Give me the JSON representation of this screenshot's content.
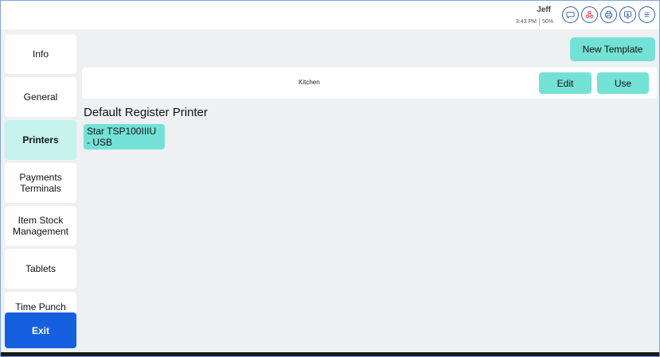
{
  "header": {
    "user_name": "Jeff",
    "time": "3:43 PM",
    "battery": "50%",
    "icons": [
      "chat-icon",
      "network-icon",
      "print-icon",
      "display-icon",
      "menu-icon"
    ]
  },
  "sidebar": {
    "items": [
      {
        "label": "Info",
        "active": false
      },
      {
        "label": "General",
        "active": false
      },
      {
        "label": "Printers",
        "active": true
      },
      {
        "label": "Payments\nTerminals",
        "active": false
      },
      {
        "label": "Item Stock\nManagement",
        "active": false
      },
      {
        "label": "Tablets",
        "active": false
      },
      {
        "label": "Time Punch",
        "active": false
      }
    ],
    "exit_label": "Exit"
  },
  "content": {
    "new_template_label": "New Template",
    "templates": [
      {
        "name": "Kitchen",
        "edit_label": "Edit",
        "use_label": "Use"
      }
    ],
    "default_printer_title": "Default Register Printer",
    "default_printer_name": "Star TSP100IIIU - USB"
  },
  "colors": {
    "accent": "#74e1d6",
    "active_nav": "#c6f3ec",
    "exit": "#1660e0",
    "background": "#eef0f3",
    "icon_border": "#2d5fa8"
  }
}
